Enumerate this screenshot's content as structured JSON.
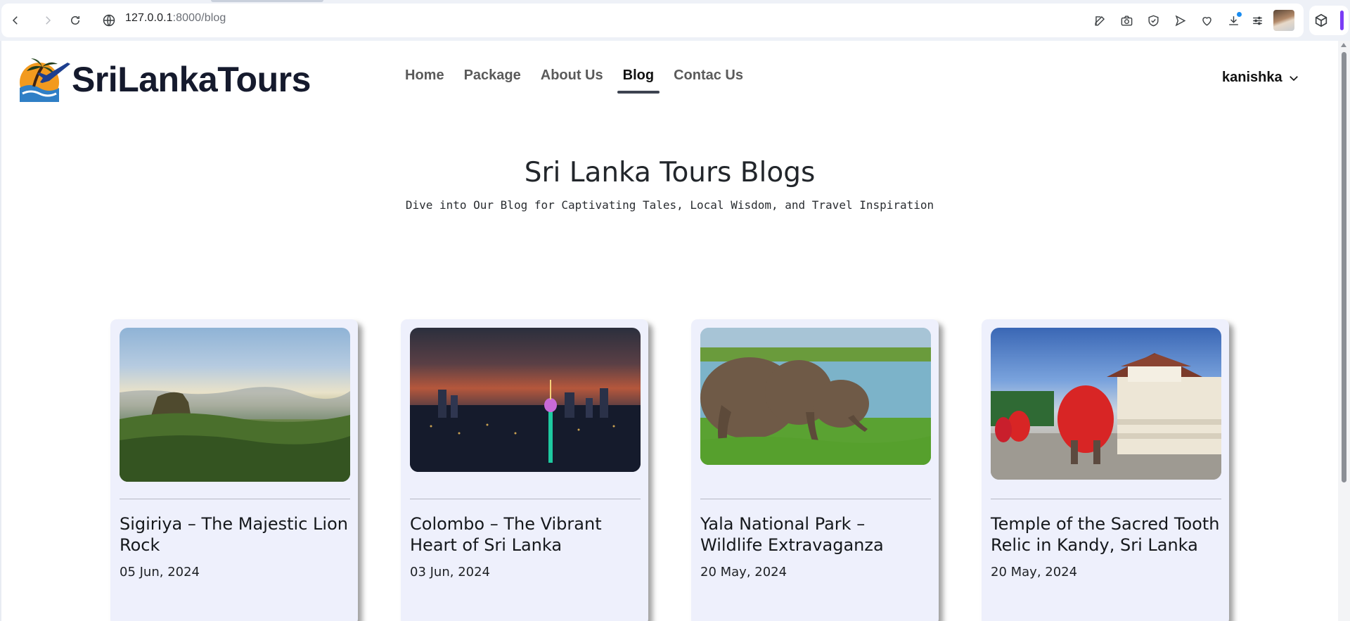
{
  "browser": {
    "url_host": "127.0.0.1",
    "url_path": ":8000/blog"
  },
  "site": {
    "logo_text": "SriLankaTours",
    "nav": [
      {
        "label": "Home"
      },
      {
        "label": "Package"
      },
      {
        "label": "About Us"
      },
      {
        "label": "Blog",
        "active": true
      },
      {
        "label": "Contac Us"
      }
    ],
    "user": "kanishka"
  },
  "hero": {
    "title": "Sri Lanka Tours Blogs",
    "subtitle": "Dive into Our Blog for Captivating Tales, Local Wisdom, and Travel Inspiration"
  },
  "posts": [
    {
      "title": "Sigiriya – The Majestic Lion Rock",
      "date": "05 Jun, 2024"
    },
    {
      "title": "Colombo – The Vibrant Heart of Sri Lanka",
      "date": "03 Jun, 2024"
    },
    {
      "title": "Yala National Park – Wildlife Extravaganza",
      "date": "20 May, 2024"
    },
    {
      "title": "Temple of the Sacred Tooth Relic in Kandy, Sri Lanka",
      "date": "20 May, 2024"
    }
  ],
  "colors": {
    "card_bg": "#eef0fc",
    "accent_underline": "#3d4350",
    "extension_accent": "#7a3cf5"
  }
}
